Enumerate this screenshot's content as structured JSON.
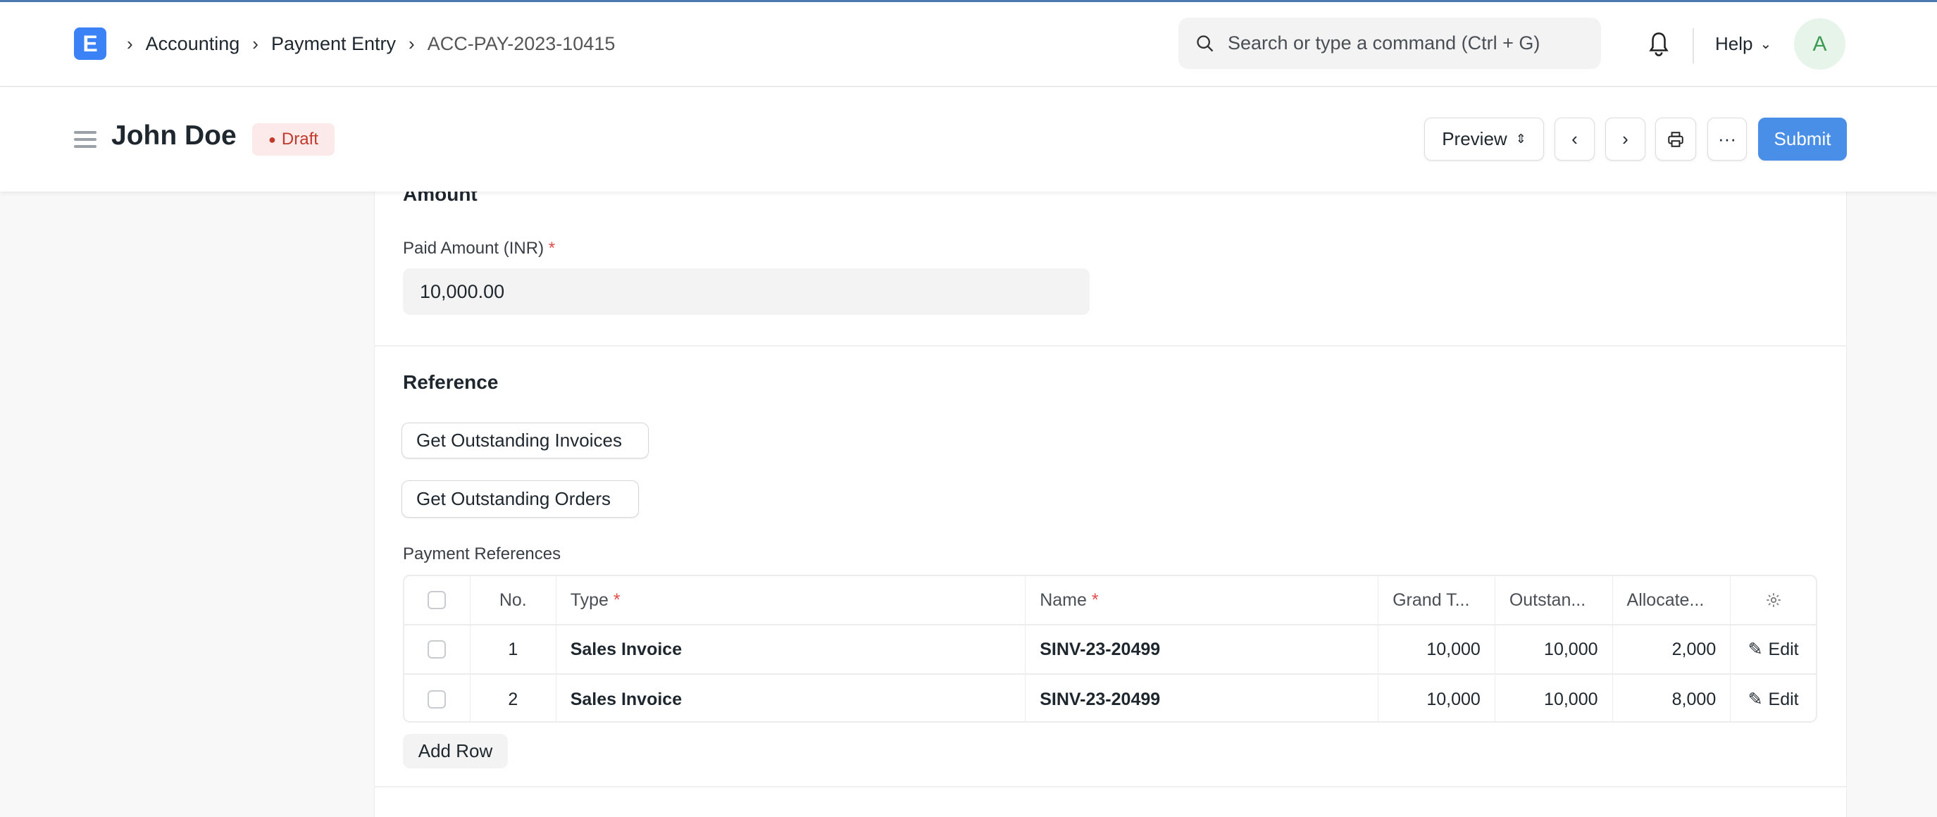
{
  "navbar": {
    "logo_letter": "E",
    "breadcrumbs": [
      "Accounting",
      "Payment Entry",
      "ACC-PAY-2023-10415"
    ],
    "search_placeholder": "Search or type a command (Ctrl + G)",
    "help_label": "Help",
    "avatar_initial": "A"
  },
  "page_head": {
    "title": "John Doe",
    "status": "Draft",
    "preview_label": "Preview",
    "more_label": "···",
    "submit_label": "Submit"
  },
  "amount_section": {
    "heading": "Amount",
    "paid_amount_label": "Paid Amount (INR)",
    "required_mark": "*",
    "paid_amount_value": "10,000.00"
  },
  "reference_section": {
    "heading": "Reference",
    "get_invoices_label": "Get Outstanding Invoices",
    "get_orders_label": "Get Outstanding Orders",
    "table_label": "Payment References",
    "columns": {
      "no": "No.",
      "type": "Type",
      "name": "Name",
      "grand_total": "Grand T...",
      "outstanding": "Outstan...",
      "allocated": "Allocate..."
    },
    "rows": [
      {
        "no": "1",
        "type": "Sales Invoice",
        "name": "SINV-23-20499",
        "grand_total": "10,000",
        "outstanding": "10,000",
        "allocated": "2,000",
        "edit": "Edit"
      },
      {
        "no": "2",
        "type": "Sales Invoice",
        "name": "SINV-23-20499",
        "grand_total": "10,000",
        "outstanding": "10,000",
        "allocated": "8,000",
        "edit": "Edit"
      }
    ],
    "add_row_label": "Add Row"
  },
  "colors": {
    "accent": "#4a8fe7",
    "logo": "#3b82f6",
    "draft_badge_bg": "#fce9e9",
    "draft_badge_text": "#c0392b"
  }
}
